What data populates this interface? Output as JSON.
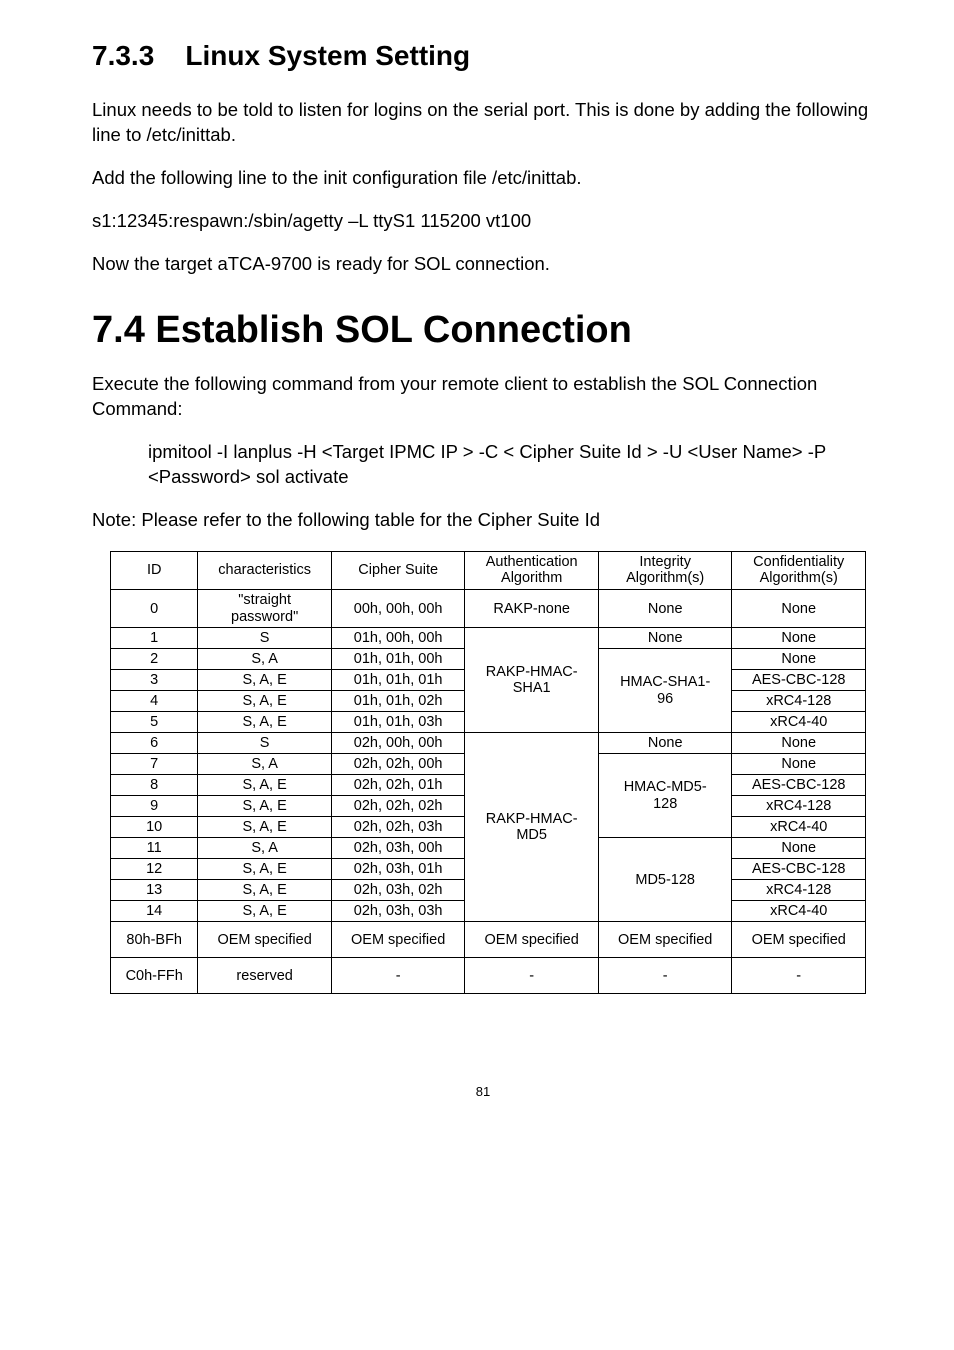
{
  "section733": {
    "number": "7.3.3",
    "title": "Linux System Setting",
    "para1": "Linux needs to be told to listen for logins on the serial port. This is done by adding the following line to /etc/inittab.",
    "para2": "Add the following line to the init configuration file /etc/inittab.",
    "code": "s1:12345:respawn:/sbin/agetty –L ttyS1 115200 vt100",
    "para3": "Now the target aTCA-9700 is ready for SOL connection."
  },
  "section74": {
    "number": "7.4",
    "title": "Establish SOL Connection",
    "para1": "Execute the following command from your remote client to establish the SOL Connection Command:",
    "cmd": "ipmitool -I lanplus -H <Target IPMC IP > -C < Cipher Suite Id > -U <User Name> -P <Password> sol activate",
    "note": "Note: Please refer to the following table for the Cipher Suite Id"
  },
  "table": {
    "headers": {
      "id": "ID",
      "char": "characteristics",
      "cs": "Cipher Suite",
      "auth1": "Authentication",
      "auth2": "Algorithm",
      "int1": "Integrity",
      "int2": "Algorithm(s)",
      "conf1": "Confidentiality",
      "conf2": "Algorithm(s)"
    },
    "r0": {
      "id": "0",
      "char1": "\"straight",
      "char2": "password\"",
      "cs": "00h, 00h, 00h",
      "auth": "RAKP-none",
      "int": "None",
      "conf": "None"
    },
    "r1": {
      "id": "1",
      "char": "S",
      "cs": "01h, 00h, 00h",
      "int": "None",
      "conf": "None"
    },
    "r2": {
      "id": "2",
      "char": "S, A",
      "cs": "01h, 01h, 00h",
      "conf": "None"
    },
    "r3": {
      "id": "3",
      "char": "S, A, E",
      "cs": "01h, 01h, 01h",
      "conf": "AES-CBC-128"
    },
    "r4": {
      "id": "4",
      "char": "S, A, E",
      "cs": "01h, 01h, 02h",
      "conf": "xRC4-128"
    },
    "r5": {
      "id": "5",
      "char": "S, A, E",
      "cs": "01h, 01h, 03h",
      "conf": "xRC4-40"
    },
    "r6": {
      "id": "6",
      "char": "S",
      "cs": "02h, 00h, 00h",
      "int": "None",
      "conf": "None"
    },
    "r7": {
      "id": "7",
      "char": "S, A",
      "cs": "02h, 02h, 00h",
      "conf": "None"
    },
    "r8": {
      "id": "8",
      "char": "S, A, E",
      "cs": "02h, 02h, 01h",
      "conf": "AES-CBC-128"
    },
    "r9": {
      "id": "9",
      "char": "S, A, E",
      "cs": "02h, 02h, 02h",
      "conf": "xRC4-128"
    },
    "r10": {
      "id": "10",
      "char": "S, A, E",
      "cs": "02h, 02h, 03h",
      "conf": "xRC4-40"
    },
    "r11": {
      "id": "11",
      "char": "S, A",
      "cs": "02h, 03h, 00h",
      "conf": "None"
    },
    "r12": {
      "id": "12",
      "char": "S, A, E",
      "cs": "02h, 03h, 01h",
      "conf": "AES-CBC-128"
    },
    "r13": {
      "id": "13",
      "char": "S, A, E",
      "cs": "02h, 03h, 02h",
      "conf": "xRC4-128"
    },
    "r14": {
      "id": "14",
      "char": "S, A, E",
      "cs": "02h, 03h, 03h",
      "conf": "xRC4-40"
    },
    "auth_rakp_sha1_1": "RAKP-HMAC-",
    "auth_rakp_sha1_2": "SHA1",
    "int_hmac_sha1_1": "HMAC-SHA1-",
    "int_hmac_sha1_2": "96",
    "auth_rakp_md5_1": "RAKP-HMAC-",
    "auth_rakp_md5_2": "MD5",
    "int_hmac_md5_1": "HMAC-MD5-",
    "int_hmac_md5_2": "128",
    "int_md5_128": "MD5-128",
    "oem": {
      "id": "80h-BFh",
      "char": "OEM specified",
      "cs": "OEM specified",
      "auth": "OEM specified",
      "int": "OEM specified",
      "conf": "OEM specified"
    },
    "res": {
      "id": "C0h-FFh",
      "char": "reserved",
      "cs": "-",
      "auth": "-",
      "int": "-",
      "conf": "-"
    }
  },
  "pagenum": "81"
}
